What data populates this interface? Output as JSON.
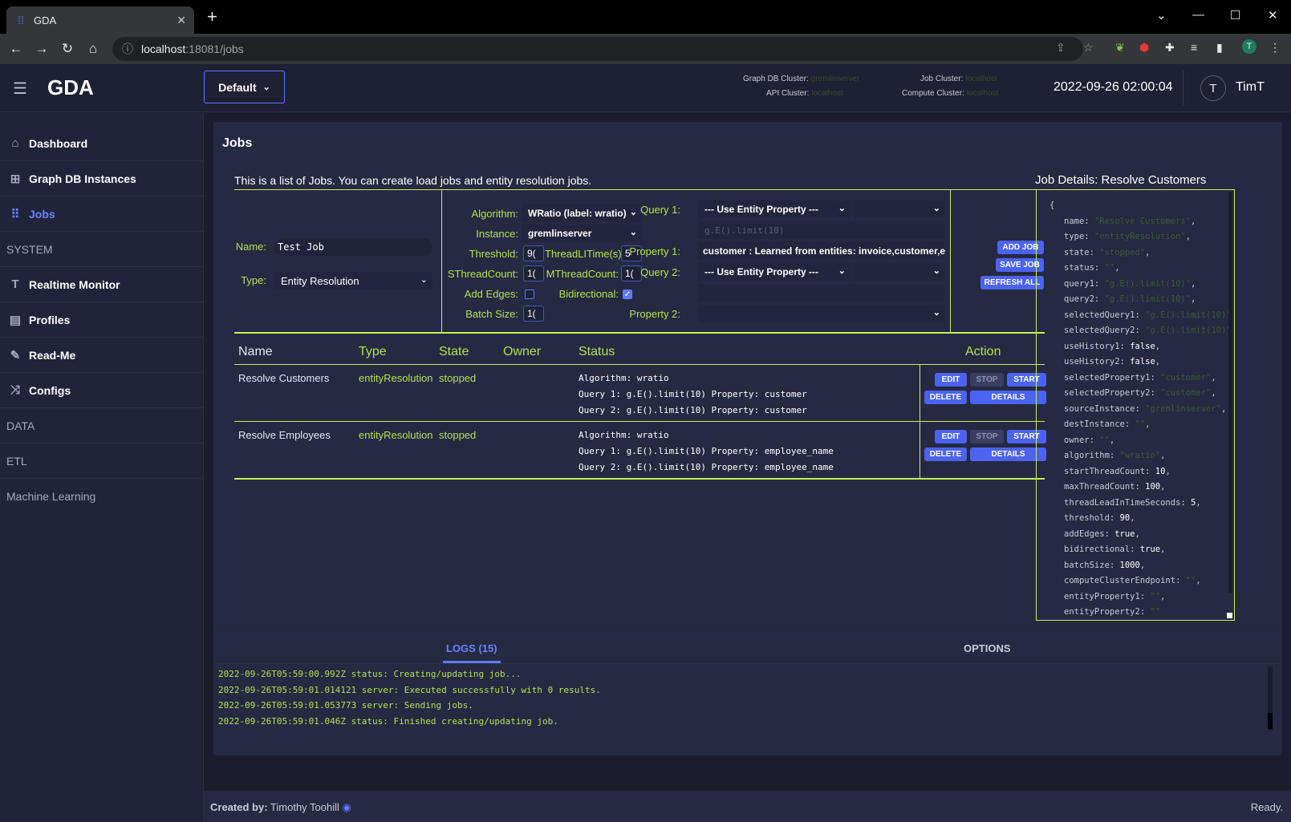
{
  "browser": {
    "tab_title": "GDA",
    "url_host": "localhost",
    "url_path": ":18081/jobs",
    "profile_initial": "T"
  },
  "header": {
    "logo": "GDA",
    "instance_select": "Default",
    "clusters": {
      "graph_db_label": "Graph DB Cluster:",
      "graph_db_value": "gremlinserver",
      "job_label": "Job Cluster:",
      "job_value": "localhost",
      "api_label": "API Cluster:",
      "api_value": "localhost",
      "compute_label": "Compute Cluster:",
      "compute_value": "localhost"
    },
    "datetime": "2022-09-26 02:00:04",
    "avatar_initial": "T",
    "user": "TimT"
  },
  "sidebar": {
    "items": [
      {
        "label": "Dashboard",
        "icon": "home-icon"
      },
      {
        "label": "Graph DB Instances",
        "icon": "grid-icon"
      },
      {
        "label": "Jobs",
        "icon": "apps-icon",
        "active": true
      }
    ],
    "sections": [
      "SYSTEM",
      "DATA",
      "ETL",
      "Machine Learning"
    ],
    "system_items": [
      {
        "label": "Realtime Monitor",
        "icon": "text-icon"
      },
      {
        "label": "Profiles",
        "icon": "calendar-icon"
      },
      {
        "label": "Read-Me",
        "icon": "pencil-icon"
      },
      {
        "label": "Configs",
        "icon": "shuffle-icon"
      }
    ]
  },
  "main": {
    "title": "Jobs",
    "intro": "This is a list of Jobs. You can create load jobs and entity resolution jobs."
  },
  "form": {
    "name_label": "Name:",
    "name_value": "Test Job",
    "type_label": "Type:",
    "type_value": "Entity Resolution",
    "algorithm_label": "Algorithm:",
    "algorithm_value": "WRatio (label: wratio)",
    "instance_label": "Instance:",
    "instance_value": "gremlinserver",
    "threshold_label": "Threshold:",
    "threshold_value": "9(",
    "leadtime_label": "ThreadLITime(s):",
    "leadtime_value": "5",
    "sthread_label": "SThreadCount:",
    "sthread_value": "1(",
    "mthread_label": "MThreadCount:",
    "mthread_value": "1(",
    "addedges_label": "Add Edges:",
    "addedges_checked": false,
    "bidirectional_label": "Bidirectional:",
    "bidirectional_checked": true,
    "batch_label": "Batch Size:",
    "batch_value": "1(",
    "query1_label": "Query 1:",
    "query1_select": "--- Use Entity Property ---",
    "query1_placeholder": "g.E().limit(10)",
    "property1_label": "Property 1:",
    "property1_value": "customer : Learned from entities: invoice,customer,er",
    "query2_label": "Query 2:",
    "query2_select": "--- Use Entity Property ---",
    "property2_label": "Property 2:",
    "property2_value": ""
  },
  "actions": {
    "add": "ADD JOB",
    "save": "SAVE JOB",
    "refresh": "REFRESH ALL"
  },
  "table": {
    "headers": {
      "name": "Name",
      "type": "Type",
      "state": "State",
      "owner": "Owner",
      "status": "Status",
      "action": "Action"
    },
    "rows": [
      {
        "name": "Resolve Customers",
        "type": "entityResolution",
        "state": "stopped",
        "owner": "",
        "status1": "Algorithm: wratio",
        "status2": "Query 1: g.E().limit(10) Property: customer",
        "status3": "Query 2: g.E().limit(10) Property: customer"
      },
      {
        "name": "Resolve Employees",
        "type": "entityResolution",
        "state": "stopped",
        "owner": "",
        "status1": "Algorithm: wratio",
        "status2": "Query 1: g.E().limit(10) Property: employee_name",
        "status3": "Query 2: g.E().limit(10) Property: employee_name"
      }
    ],
    "row_buttons": {
      "edit": "EDIT",
      "stop": "STOP",
      "start": "START",
      "delete": "DELETE",
      "details": "DETAILS"
    }
  },
  "details": {
    "title": "Job Details: Resolve Customers",
    "json_lines": [
      [
        "{",
        "",
        ""
      ],
      [
        "name: ",
        "\"Resolve Customers\"",
        ","
      ],
      [
        "type: ",
        "\"entityResolution\"",
        ","
      ],
      [
        "state: ",
        "\"stopped\"",
        ","
      ],
      [
        "status: ",
        "\"\"",
        ","
      ],
      [
        "query1: ",
        "\"g.E().limit(10)\"",
        ","
      ],
      [
        "query2: ",
        "\"g.E().limit(10)\"",
        ","
      ],
      [
        "selectedQuery1: ",
        "\"g.E().limit(10)\"",
        ""
      ],
      [
        "selectedQuery2: ",
        "\"g.E().limit(10)\"",
        ""
      ],
      [
        "useHistory1: ",
        "false",
        ","
      ],
      [
        "useHistory2: ",
        "false",
        ","
      ],
      [
        "selectedProperty1: ",
        "\"customer\"",
        ","
      ],
      [
        "selectedProperty2: ",
        "\"customer\"",
        ","
      ],
      [
        "sourceInstance: ",
        "\"gremlinserver\"",
        ","
      ],
      [
        "destInstance: ",
        "\"\"",
        ","
      ],
      [
        "owner: ",
        "\"\"",
        ","
      ],
      [
        "algorithm: ",
        "\"wratio\"",
        ","
      ],
      [
        "startThreadCount: ",
        "10",
        ","
      ],
      [
        "maxThreadCount: ",
        "100",
        ","
      ],
      [
        "threadLeadInTimeSeconds: ",
        "5",
        ","
      ],
      [
        "threshold: ",
        "90",
        ","
      ],
      [
        "addEdges: ",
        "true",
        ","
      ],
      [
        "bidirectional: ",
        "true",
        ","
      ],
      [
        "batchSize: ",
        "1000",
        ","
      ],
      [
        "computeClusterEndpoint: ",
        "\"\"",
        ","
      ],
      [
        "entityProperty1: ",
        "\"\"",
        ","
      ],
      [
        "entityProperty2: ",
        "\"\"",
        ""
      ]
    ]
  },
  "logs": {
    "tab": "LOGS (15)",
    "options_tab": "OPTIONS",
    "lines": [
      "2022-09-26T05:59:00.992Z status: Creating/updating job...",
      "2022-09-26T05:59:01.014121 server: Executed successfully with 0 results.",
      "2022-09-26T05:59:01.053773 server: Sending jobs.",
      "2022-09-26T05:59:01.046Z status: Finished creating/updating job."
    ]
  },
  "footer": {
    "created_by_label": "Created by:",
    "author": "Timothy Toohill",
    "status": "Ready."
  },
  "colors": {
    "accent": "#5b7cfa",
    "lime": "#b4e04f",
    "panel": "#262942",
    "background": "#1b1d2e"
  }
}
